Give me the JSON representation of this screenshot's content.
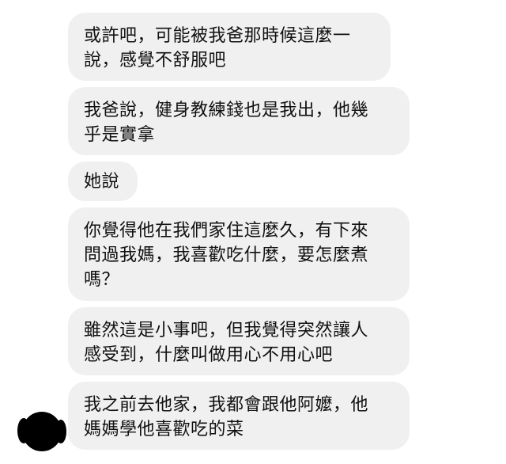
{
  "messages": [
    "或許吧，可能被我爸那時候這麼一\n說，感覺不舒服吧",
    "我爸說，健身教練錢也是我出，他幾\n乎是實拿",
    "她說",
    "你覺得他在我們家住這麼久，有下來\n問過我媽，我喜歡吃什麼，要怎麼煮\n嗎？",
    "雖然這是小事吧，但我覺得突然讓人\n感受到，什麼叫做用心不用心吧",
    "我之前去他家，我都會跟他阿嬤，他\n媽媽學他喜歡吃的菜"
  ],
  "colors": {
    "bubble_background": "#f0f0f0",
    "text": "#111111",
    "page_background": "#ffffff"
  },
  "icons": {
    "avatar": "avatar-icon"
  }
}
